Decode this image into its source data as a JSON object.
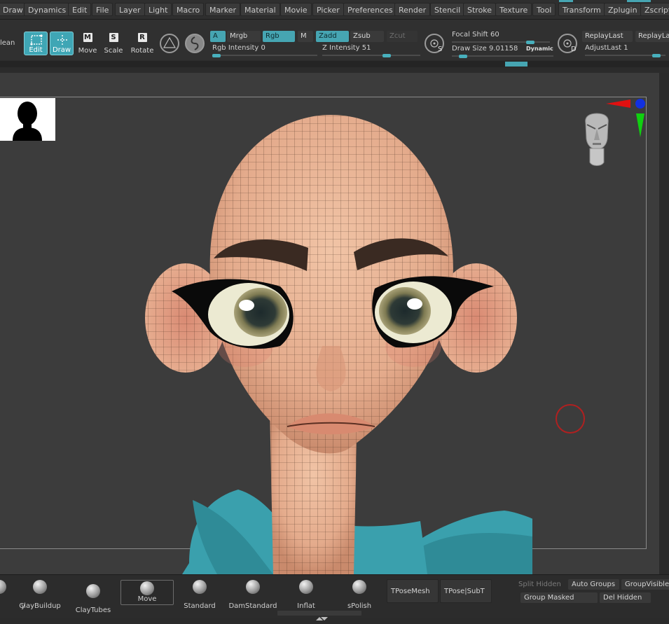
{
  "menubar": {
    "items": [
      "Draw",
      "Dynamics",
      "Edit",
      "File",
      "Layer",
      "Light",
      "Macro",
      "Marker",
      "Material",
      "Movie",
      "Picker",
      "Preferences",
      "Render",
      "Stencil",
      "Stroke",
      "Texture",
      "Tool",
      "Transform",
      "Zplugin",
      "Zscript"
    ]
  },
  "toolbar": {
    "boolean_label": "lean",
    "edit_label": "Edit",
    "draw_label": "Draw",
    "move_label": "Move",
    "scale_label": "Scale",
    "rotate_label": "Rotate",
    "a_label": "A",
    "mrgb_label": "Mrgb",
    "rgb_label": "Rgb",
    "m_label": "M",
    "zadd_label": "Zadd",
    "zsub_label": "Zsub",
    "zcut_label": "Zcut",
    "rgb_intensity": "Rgb Intensity 0",
    "z_intensity": "Z Intensity 51",
    "focal_shift": "Focal Shift 60",
    "draw_size": "Draw Size 9.01158",
    "dynamic_label": "Dynamic",
    "replay_last": "ReplayLast",
    "replay_last_2": "ReplayLa",
    "adjust_last": "AdjustLast 1",
    "s_label": "S",
    "d_label": "D"
  },
  "brushes": [
    {
      "name": "y"
    },
    {
      "name": "ClayBuildup"
    },
    {
      "name": "ClayTubes"
    },
    {
      "name": "Move"
    },
    {
      "name": "Standard"
    },
    {
      "name": "DamStandard"
    },
    {
      "name": "Inflat"
    },
    {
      "name": "sPolish"
    }
  ],
  "shelf": {
    "tpose_mesh": "TPoseMesh",
    "tpose_subt": "TPose|SubT",
    "split_hidden": "Split Hidden",
    "auto_groups": "Auto Groups",
    "group_visible": "GroupVisible",
    "group_masked": "Group Masked",
    "del_hidden": "Del Hidden"
  },
  "colors": {
    "accent": "#46a5b2",
    "skin": "#e7b092",
    "cloth": "#3aa0ad"
  }
}
